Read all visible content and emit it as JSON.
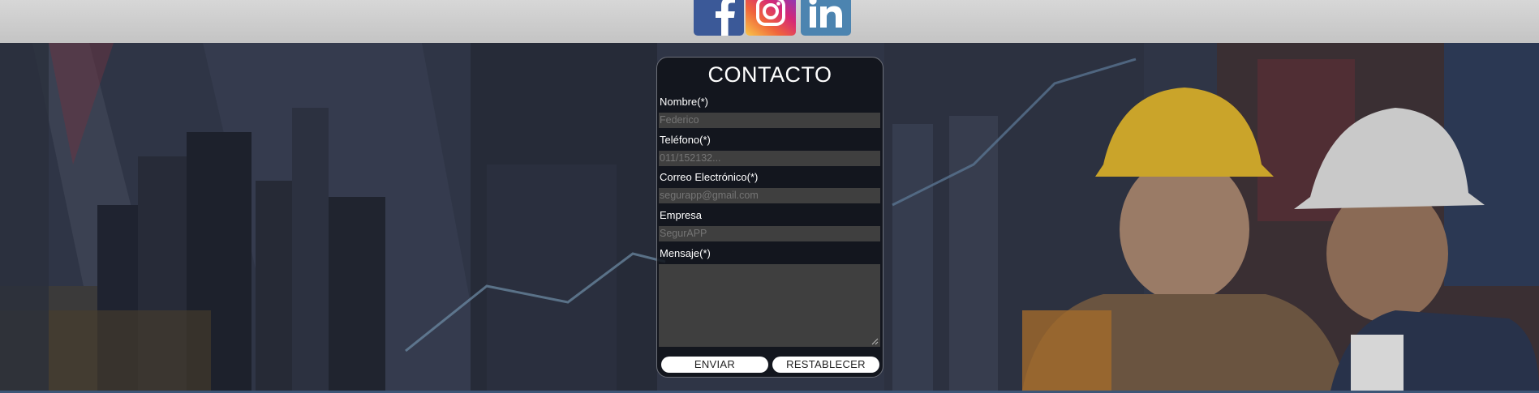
{
  "header": {
    "social": [
      {
        "name": "facebook-icon",
        "color": "#3b5998"
      },
      {
        "name": "instagram-icon",
        "color": "#d62976"
      },
      {
        "name": "linkedin-icon",
        "color": "#4c84b0"
      }
    ]
  },
  "form": {
    "title": "CONTACTO",
    "fields": [
      {
        "label": "Nombre(*)",
        "placeholder": "Federico"
      },
      {
        "label": "Teléfono(*)",
        "placeholder": "011/152132..."
      },
      {
        "label": "Correo Electrónico(*)",
        "placeholder": "segurapp@gmail.com"
      },
      {
        "label": "Empresa",
        "placeholder": "SegurAPP"
      }
    ],
    "message_label": "Mensaje(*)",
    "submit_label": "ENVIAR",
    "reset_label": "RESTABLECER"
  },
  "colors": {
    "header_bg": "#c8c8c8",
    "form_bg": "#0e1016",
    "field_bg": "#3f3f3f",
    "button_bg": "#ffffff",
    "bottom_strip": "#3d5677"
  }
}
